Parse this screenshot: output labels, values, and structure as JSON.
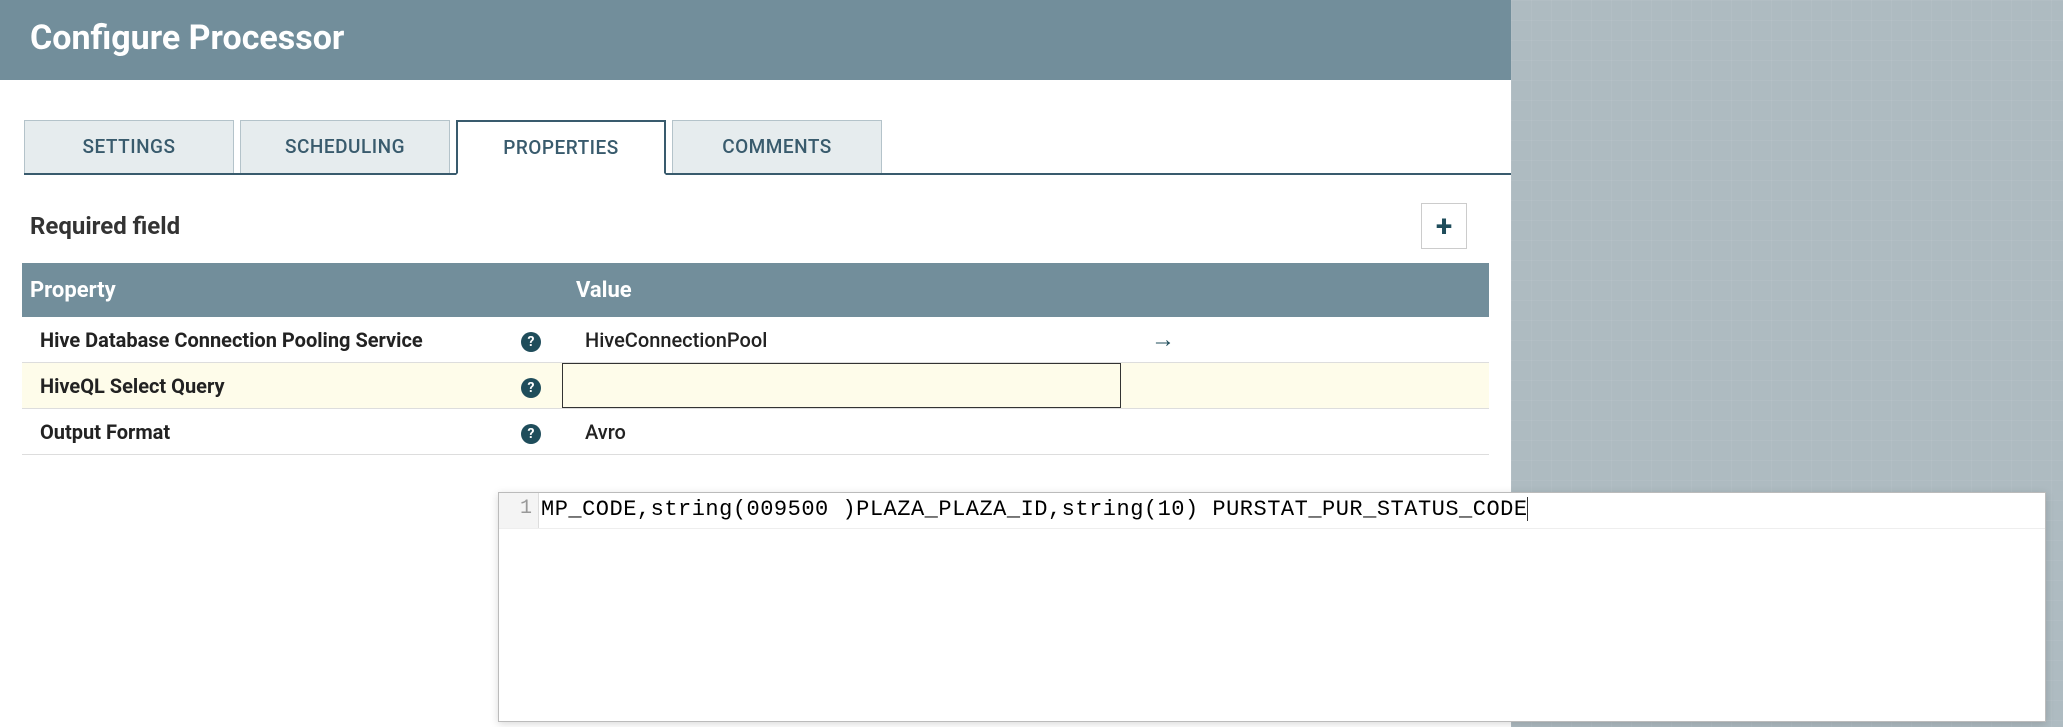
{
  "header": {
    "title": "Configure Processor"
  },
  "tabs": [
    {
      "label": "SETTINGS",
      "active": false
    },
    {
      "label": "SCHEDULING",
      "active": false
    },
    {
      "label": "PROPERTIES",
      "active": true
    },
    {
      "label": "COMMENTS",
      "active": false
    }
  ],
  "required_label": "Required field",
  "table": {
    "head_property": "Property",
    "head_value": "Value",
    "rows": [
      {
        "name": "Hive Database Connection Pooling Service",
        "value": "HiveConnectionPool",
        "goto": true,
        "highlight": false
      },
      {
        "name": "HiveQL Select Query",
        "value": "",
        "goto": false,
        "highlight": true
      },
      {
        "name": "Output Format",
        "value": "Avro",
        "goto": false,
        "highlight": false
      }
    ]
  },
  "editor": {
    "line_number": "1",
    "code": "MP_CODE,string(009500 )PLAZA_PLAZA_ID,string(10) PURSTAT_PUR_STATUS_CODE"
  }
}
